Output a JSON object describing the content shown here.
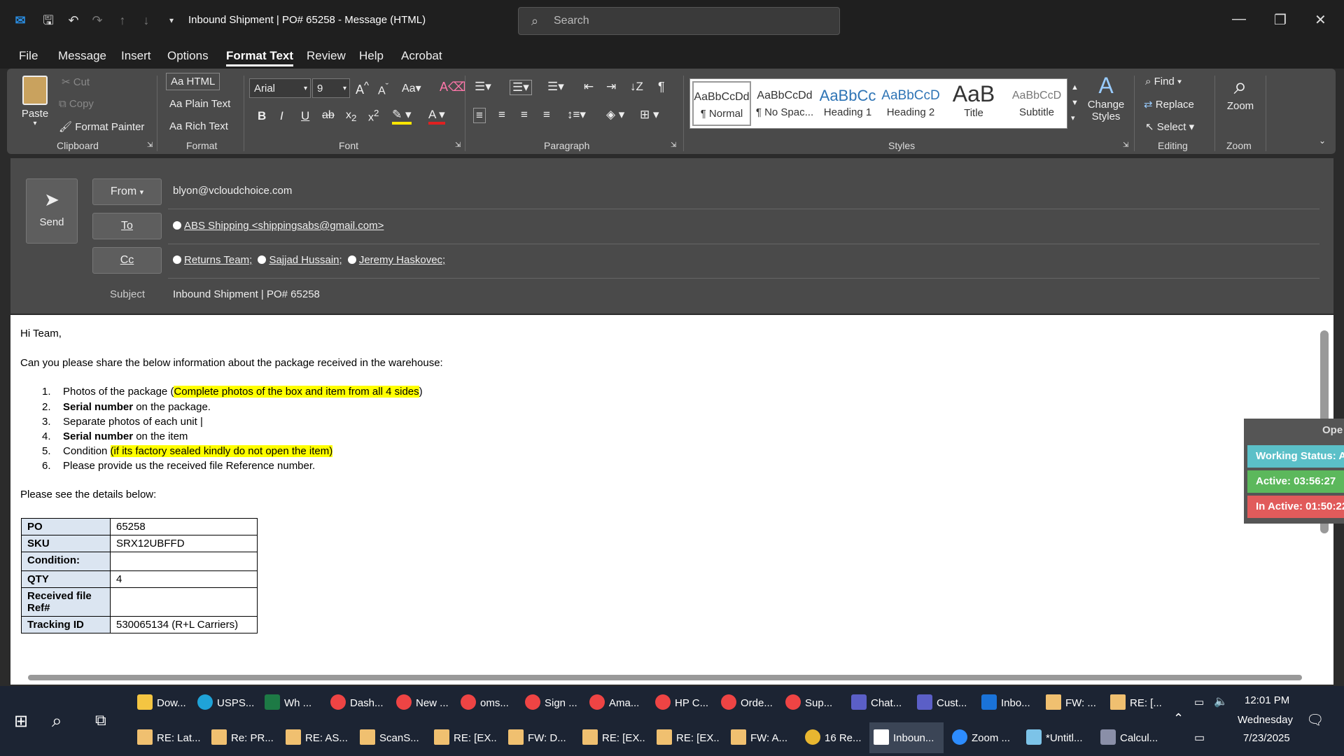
{
  "window": {
    "title": "Inbound Shipment | PO# 65258  -  Message (HTML)",
    "search_placeholder": "Search"
  },
  "menus": [
    "File",
    "Message",
    "Insert",
    "Options",
    "Format Text",
    "Review",
    "Help",
    "Acrobat"
  ],
  "ribbon": {
    "clipboard": {
      "paste": "Paste",
      "cut": "Cut",
      "copy": "Copy",
      "format_painter": "Format Painter",
      "label": "Clipboard"
    },
    "format": {
      "html": "Aa HTML",
      "plain": "Aa Plain Text",
      "rich": "Aa Rich Text",
      "label": "Format"
    },
    "font": {
      "name": "Arial",
      "size": "9",
      "label": "Font"
    },
    "paragraph": {
      "label": "Paragraph"
    },
    "styles": {
      "items": [
        {
          "sample": "AaBbCcDd",
          "name": "¶ Normal"
        },
        {
          "sample": "AaBbCcDd",
          "name": "¶ No Spac..."
        },
        {
          "sample": "AaBbCc",
          "name": "Heading 1"
        },
        {
          "sample": "AaBbCcD",
          "name": "Heading 2"
        },
        {
          "sample": "AaB",
          "name": "Title"
        },
        {
          "sample": "AaBbCcD",
          "name": "Subtitle"
        }
      ],
      "change": "Change Styles",
      "label": "Styles"
    },
    "editing": {
      "find": "Find",
      "replace": "Replace",
      "select": "Select",
      "label": "Editing"
    },
    "zoom": {
      "btn": "Zoom",
      "label": "Zoom"
    }
  },
  "header": {
    "send": "Send",
    "from_btn": "From",
    "from_value": "blyon@vcloudchoice.com",
    "to_btn": "To",
    "to_value": "ABS Shipping <shippingsabs@gmail.com>",
    "cc_btn": "Cc",
    "cc": [
      "Returns Team;",
      "Sajjad Hussain;",
      "Jeremy Haskovec;"
    ],
    "subject_label": "Subject",
    "subject_value": "Inbound Shipment | PO# 65258"
  },
  "body": {
    "greeting": "Hi Team,",
    "intro": "Can you please share the below information about the package received in the warehouse:",
    "items": [
      {
        "n": "1.",
        "pre": "Photos of the package (",
        "hl": "Complete photos of the box and item from all 4 sides",
        "post": ")"
      },
      {
        "n": "2.",
        "bold": "Serial number",
        "post": " on the package."
      },
      {
        "n": "3.",
        "pre": "Separate photos of each unit |"
      },
      {
        "n": "4.",
        "bold": "Serial number",
        "post": " on the item"
      },
      {
        "n": "5.",
        "pre": "Condition ",
        "hl": "(if its factory sealed kindly do not open the item)"
      },
      {
        "n": "6.",
        "pre": "Please provide us the received file Reference number."
      }
    ],
    "details_intro": "Please see the details below:",
    "table": [
      {
        "k": "PO",
        "v": "65258"
      },
      {
        "k": "SKU",
        "v": "SRX12UBFFD"
      },
      {
        "k": "Condition:",
        "v": ""
      },
      {
        "k": "QTY",
        "v": "4"
      },
      {
        "k": "Received file Ref#",
        "v": ""
      },
      {
        "k": "Tracking ID",
        "v": "530065134 (R+L Carriers)"
      }
    ]
  },
  "widget": {
    "top": "Ope",
    "working": "Working Status: A",
    "active": "Active: 03:56:27",
    "inactive": "In Active: 01:50:22",
    "colors": {
      "working": "#5bc0c8",
      "active": "#5cb85c",
      "inactive": "#e15b5b"
    }
  },
  "taskbar": {
    "row1": [
      "Dow...",
      "USPS...",
      "Wh ...",
      "Dash...",
      "New ...",
      "oms...",
      "Sign ...",
      "Ama...",
      "HP C...",
      "Orde...",
      "Sup...",
      "Chat...",
      "Cust...",
      "Inbo...",
      "FW: ...",
      "RE: [..."
    ],
    "row2": [
      "RE: Lat...",
      "Re: PR...",
      "RE: AS...",
      "ScanS...",
      "RE: [EX...",
      "FW: D...",
      "RE: [EX...",
      "RE: [EX...",
      "FW: A...",
      "16 Re...",
      "Inboun...",
      "Zoom ...",
      "*Untitl...",
      "Calcul..."
    ],
    "time": "12:01 PM",
    "day": "Wednesday",
    "date": "7/23/2025"
  }
}
